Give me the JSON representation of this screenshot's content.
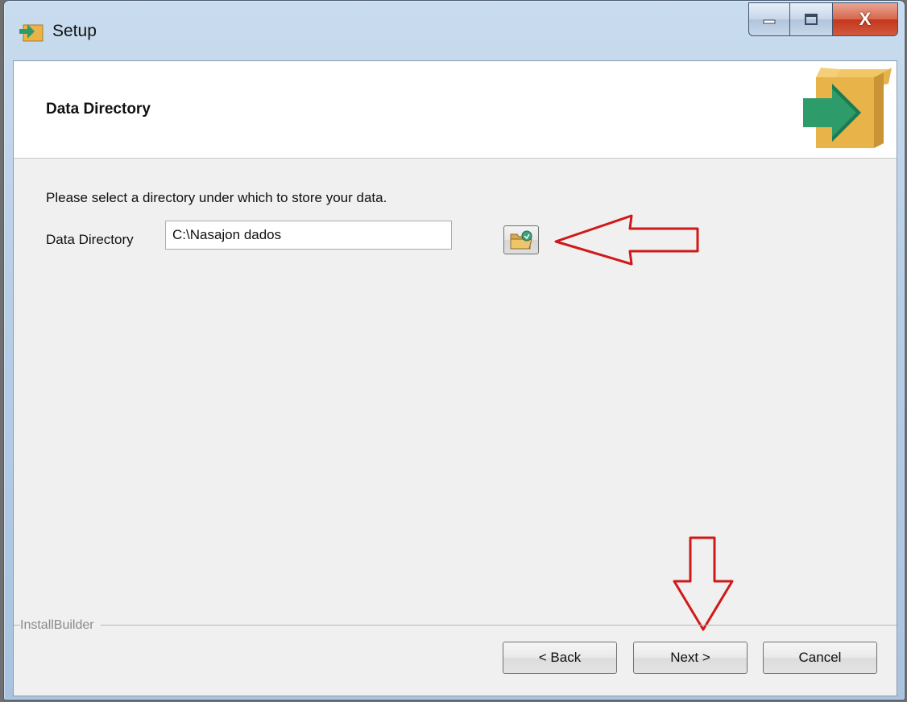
{
  "window": {
    "title": "Setup",
    "controls": {
      "minimize": "minimize",
      "maximize": "maximize",
      "close": "X"
    }
  },
  "header": {
    "title": "Data Directory",
    "logo_icon": "installer-box-arrow-icon"
  },
  "body": {
    "instruction": "Please select a directory under which to store your data.",
    "field_label": "Data Directory",
    "field_value": "C:\\Nasajon dados",
    "browse_icon": "folder-browse-icon"
  },
  "footer": {
    "brand": "InstallBuilder",
    "back_label": "< Back",
    "next_label": "Next >",
    "cancel_label": "Cancel"
  },
  "annotations": {
    "arrow_color": "#d01919"
  },
  "colors": {
    "client_bg": "#f0f0f0",
    "header_bg": "#ffffff",
    "logo_arrow": "#2e9b6a",
    "logo_box": "#e8b44a"
  }
}
